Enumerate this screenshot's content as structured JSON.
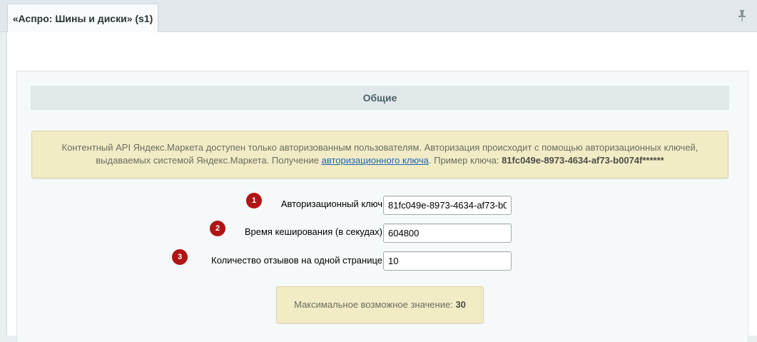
{
  "tab": {
    "title": "«Аспро: Шины и диски» (s1)"
  },
  "pin_icon": "pin-icon",
  "section": {
    "title": "Общие"
  },
  "note": {
    "text_before": "Контентный API Яндекс.Маркета доступен только авторизованным пользователям. Авторизация происходит с помощью авторизационных ключей,",
    "text_line2_before": "выдаваемых системой Яндекс.Маркета. Получение ",
    "link_text": "авторизационного ключа",
    "text_line2_after": ". Пример ключа: ",
    "example_key": "81fc049e-8973-4634-af73-b0074f******"
  },
  "fields": [
    {
      "badge": "1",
      "label": "Авторизационный ключ",
      "value": "81fc049e-8973-4634-af73-b0"
    },
    {
      "badge": "2",
      "label": "Время кеширования (в секудах)",
      "value": "604800"
    },
    {
      "badge": "3",
      "label": "Количество отзывов на одной странице",
      "value": "10"
    }
  ],
  "hint": {
    "text": "Максимальное возможное значение: ",
    "value": "30"
  },
  "colors": {
    "badge": "#b01515",
    "note_bg": "#f1ebc6",
    "link": "#2066b0",
    "section_bg": "#e0e8ea"
  }
}
